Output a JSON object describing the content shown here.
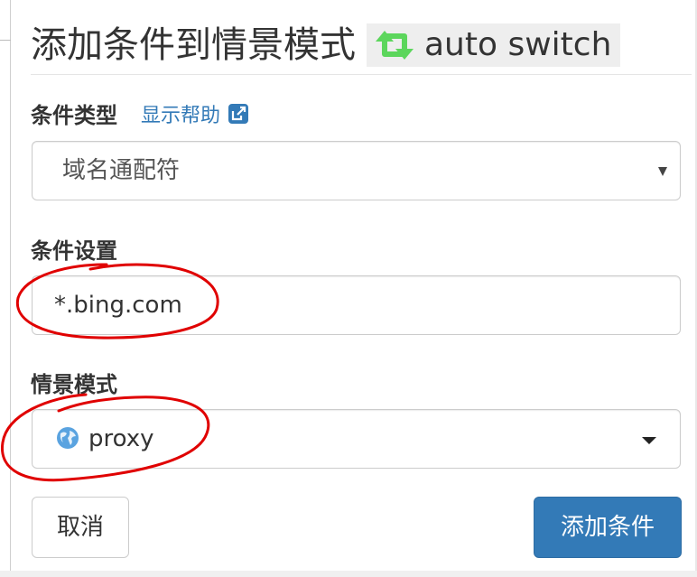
{
  "dialog": {
    "title": "添加条件到情景模式",
    "profile_name": "auto switch",
    "profile_icon": "retweet-icon",
    "profile_icon_color": "#5cd65c"
  },
  "condition_type": {
    "label": "条件类型",
    "help_text": "显示帮助",
    "help_icon": "external-link-icon",
    "selected_value": "域名通配符"
  },
  "condition_settings": {
    "label": "条件设置",
    "value": "*.bing.com"
  },
  "profile": {
    "label": "情景模式",
    "selected_value": "proxy",
    "icon": "globe-icon"
  },
  "buttons": {
    "cancel_label": "取消",
    "add_label": "添加条件"
  },
  "colors": {
    "primary": "#337ab7",
    "link": "#337ab7",
    "annotation": "#e00000"
  }
}
